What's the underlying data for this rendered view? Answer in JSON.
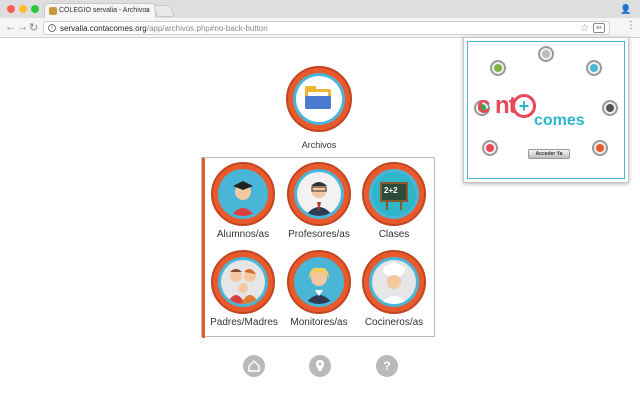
{
  "browser": {
    "tab_title": "COLEGIO servalia - Archivos",
    "tab_close": "×",
    "url_host": "servalia.contacomes.org",
    "url_path": "/app/archivos.php#no-back-button"
  },
  "main": {
    "archivos_label": "Archivos",
    "grid": [
      {
        "label": "Alumnos/as"
      },
      {
        "label": "Profesores/as"
      },
      {
        "label": "Clases"
      },
      {
        "label": "Padres/Madres"
      },
      {
        "label": "Monitores/as"
      },
      {
        "label": "Cocineros/as"
      }
    ],
    "clases_badge": "2+2"
  },
  "popup": {
    "logo_conta": "c nta",
    "logo_plus": "+",
    "logo_comes": "comes",
    "button": "Acceder Ya"
  },
  "colors": {
    "ring": "#e85a2c",
    "teal": "#2fb5c9",
    "pink": "#e9485a"
  }
}
